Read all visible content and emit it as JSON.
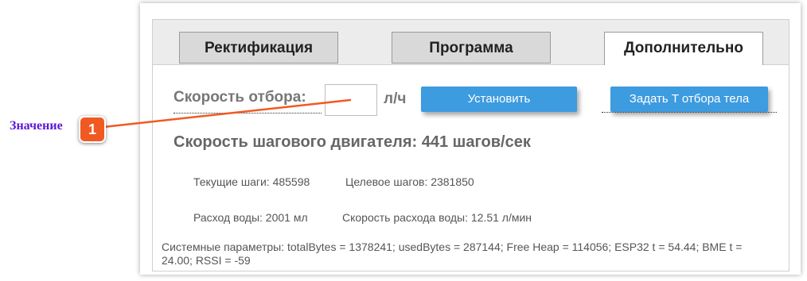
{
  "tabs": [
    {
      "label": "Ректификация",
      "active": false
    },
    {
      "label": "Программа",
      "active": false
    },
    {
      "label": "Дополнительно",
      "active": true
    }
  ],
  "rate": {
    "label": "Скорость отбора:",
    "value": "",
    "unit": "л/ч"
  },
  "buttons": {
    "set": "Установить",
    "body_temp": "Задать T отбора тела"
  },
  "motor_speed": "Скорость шагового двигателя: 441 шагов/сек",
  "stats": {
    "current_steps": "Текущие шаги: 485598",
    "target_steps": "Целевое шагов: 2381850",
    "water_flow": "Расход воды: 2001 мл",
    "water_rate": "Скорость расхода воды: 12.51 л/мин"
  },
  "system_params": "Системные параметры: totalBytes = 1378241; usedBytes = 287144; Free Heap = 114056; ESP32 t = 54.44; BME t = 24.00; RSSI = -59",
  "annotation": {
    "label": "Значение",
    "badge": "1",
    "color": "#f05a22",
    "label_color": "#5b17d6"
  },
  "colors": {
    "button": "#3d9be0",
    "tab_inactive": "#d9d9d9"
  }
}
